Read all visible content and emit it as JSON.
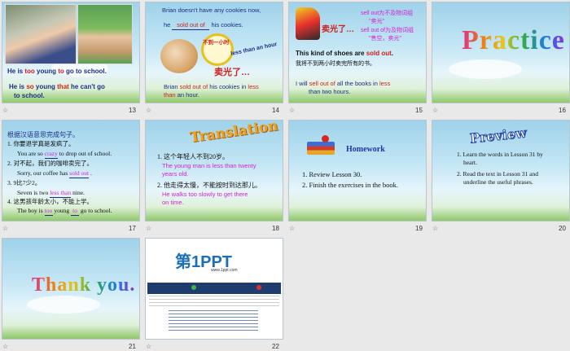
{
  "slides": [
    {
      "num": "13",
      "lines": {
        "l1a": "He is ",
        "l1b": "too",
        "l1c": " young ",
        "l1d": "to",
        "l1e": " go to school.",
        "l2a": "He is ",
        "l2b": "so",
        "l2c": " young ",
        "l2d": "that",
        "l2e": " he can't go",
        "l3": "to school."
      }
    },
    {
      "num": "14",
      "lines": {
        "a": "Brian doesn't have any cookies now,",
        "b1": "he ",
        "b2": "sold out of",
        "b3": " his cookies.",
        "clock": "不到一小时",
        "less": "less than an hour",
        "sold": "卖光了…",
        "c1": "Brian ",
        "c2": "sold out of",
        "c3": " his cookies in ",
        "c4": "less",
        "c5": "than",
        "c6": " an hour."
      }
    },
    {
      "num": "15",
      "lines": {
        "sold": "卖光了…",
        "n1": "sell out为不及物词组",
        "n1b": "\"卖光\"",
        "n2": "sell out of为及物词组",
        "n2b": "\"售空，卖光\"",
        "a1": "This kind of shoes are ",
        "a2": "sold out",
        "a3": ".",
        "b": "我将不到两小时卖完所有的书。",
        "c1": "I will ",
        "c2": "sell out of",
        "c3": " all the books in ",
        "c4": "less",
        "c5": "than two hours."
      }
    },
    {
      "num": "16",
      "title": "Practice"
    },
    {
      "num": "17",
      "lines": {
        "h": "根据汉语意思完成句子。",
        "q1": "1. 你要退学真是发疯了。",
        "a1a": "You are so ",
        "a1b": "crazy",
        "a1c": "  to drop out of school.",
        "q2": "2. 对不起，我们的咖啡卖完了。",
        "a2a": "Sorry, our coffee has ",
        "a2b": "sold out",
        "a2c": " .",
        "q3": "3. 9比7少2。",
        "a3a": "Seven is two ",
        "a3b": "less than",
        "a3c": "  nine.",
        "q4": "4. 这男孩年龄太小，不能上学。",
        "a4a": "The boy is ",
        "a4b": "too",
        "a4c": " young ",
        "a4d": "to",
        "a4e": " go to school."
      }
    },
    {
      "num": "18",
      "title": "Translation",
      "lines": {
        "q1": "1. 这个年轻人不到20岁。",
        "a1": "The young man is less than twenty",
        "a1b": "years old.",
        "q2": "2. 他走得太慢，不能按时到达那儿。",
        "a2": "He walks too slowly to get there",
        "a2b": "on time."
      }
    },
    {
      "num": "19",
      "title": "Homework",
      "lines": {
        "h1": "1. Review Lesson 30.",
        "h2": "2. Finish the exercises in the book."
      }
    },
    {
      "num": "20",
      "title": "Preview",
      "lines": {
        "p1": "1. Learn the words in Lesson 31 by",
        "p1b": "heart.",
        "p2": "2. Read the text in Lesson 31 and",
        "p2b": "underline the useful phrases."
      }
    },
    {
      "num": "21",
      "title": "Thank you."
    },
    {
      "num": "22",
      "logo": "第1PPT",
      "logo_sub": "www.1ppt.com"
    }
  ],
  "star_icon": "slide-transition-star-icon"
}
